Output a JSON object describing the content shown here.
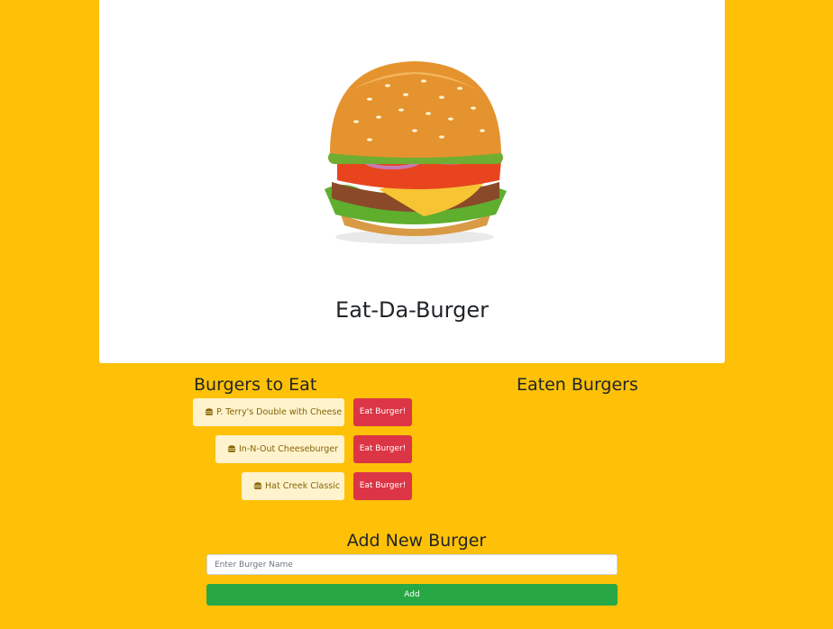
{
  "hero": {
    "title": "Eat-Da-Burger",
    "image_icon": "hamburger-illustration"
  },
  "columns": {
    "to_eat_heading": "Burgers to Eat",
    "eaten_heading": "Eaten Burgers"
  },
  "burgers_to_eat": [
    {
      "name": "P. Terry's Double with Cheese",
      "icon": "hamburger-icon",
      "action_label": "Eat Burger!"
    },
    {
      "name": "In-N-Out Cheeseburger",
      "icon": "hamburger-icon",
      "action_label": "Eat Burger!"
    },
    {
      "name": "Hat Creek Classic",
      "icon": "hamburger-icon",
      "action_label": "Eat Burger!"
    }
  ],
  "eaten_burgers": [],
  "add_form": {
    "heading": "Add New Burger",
    "input_placeholder": "Enter Burger Name",
    "input_value": "",
    "submit_label": "Add"
  },
  "colors": {
    "background": "#fec107",
    "eat_button": "#dc3545",
    "add_button": "#28a745",
    "burger_chip": "#fff3cd"
  }
}
